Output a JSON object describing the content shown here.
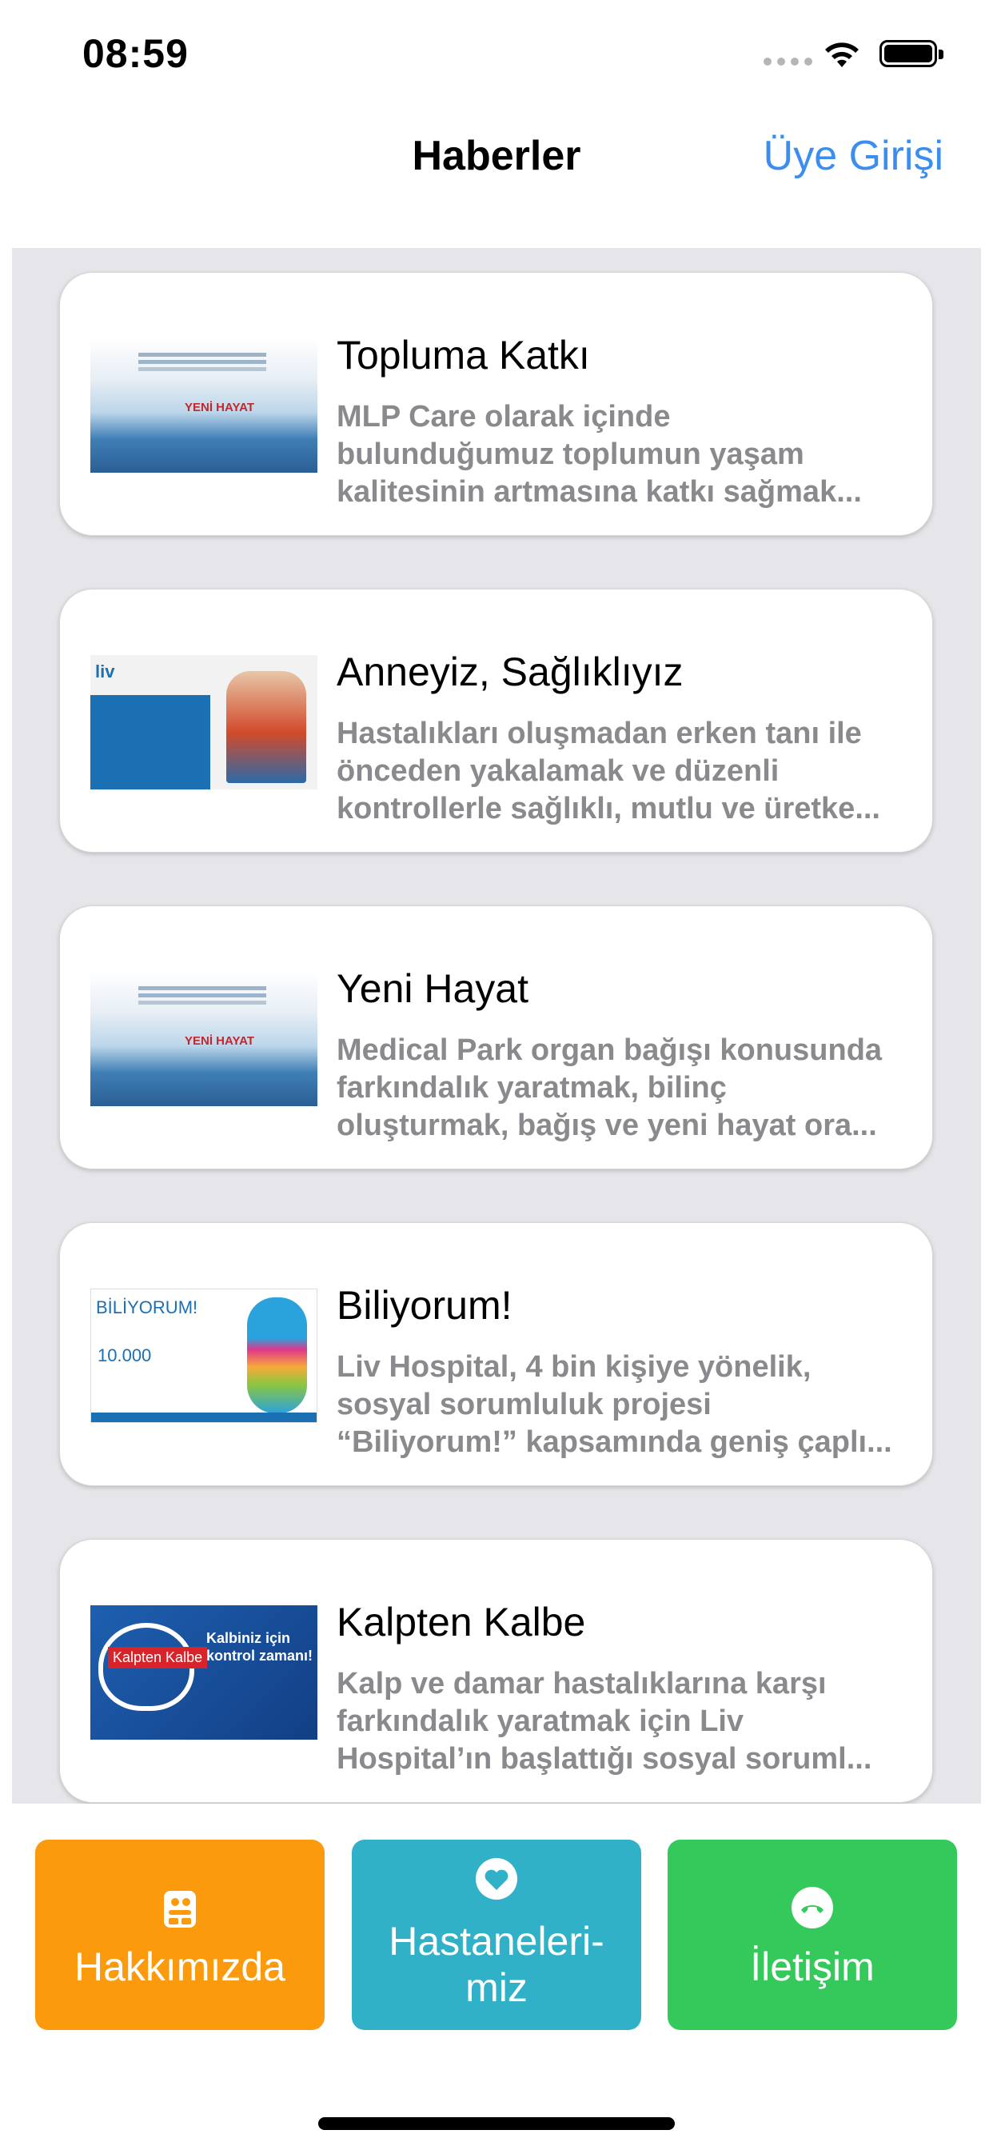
{
  "status_bar": {
    "time": "08:59"
  },
  "nav": {
    "title": "Haberler",
    "action": "Üye Girişi"
  },
  "news": [
    {
      "title": "Topluma Katkı",
      "desc_lines": [
        "MLP Care olarak içinde",
        "bulunduğumuz toplumun yaşam",
        "kalitesinin artmasına katkı sağmak..."
      ],
      "thumb": "sea",
      "thumb_text": "YENİ HAYAT"
    },
    {
      "title": "Anneyiz, Sağlıklıyız",
      "desc_lines": [
        "Hastalıkları oluşmadan erken tanı ile",
        "önceden yakalamak ve düzenli",
        "kontrollerle sağlıklı, mutlu ve üretke..."
      ],
      "thumb": "liv",
      "thumb_text": "liv"
    },
    {
      "title": "Yeni Hayat",
      "desc_lines": [
        "Medical Park organ bağışı konusunda",
        "farkındalık yaratmak, bilinç",
        "oluşturmak, bağış ve yeni hayat ora..."
      ],
      "thumb": "sea",
      "thumb_text": "YENİ HAYAT"
    },
    {
      "title": "Biliyorum!",
      "desc_lines": [
        "Liv Hospital, 4 bin kişiye yönelik,",
        "sosyal sorumluluk projesi",
        "“Biliyorum!” kapsamında geniş çaplı..."
      ],
      "thumb": "biliyorum",
      "thumb_text": "BİLİYORUM!",
      "thumb_text2": "10.000"
    },
    {
      "title": "Kalpten Kalbe",
      "desc_lines": [
        "Kalp ve damar hastalıklarına karşı",
        "farkındalık yaratmak için Liv",
        "Hospital’ın başlattığı sosyal soruml..."
      ],
      "thumb": "kalpten",
      "thumb_text": "Kalpten Kalbe",
      "thumb_text2": "Kalbiniz için kontrol zamanı!"
    }
  ],
  "tabs": {
    "about": {
      "label": "Hakkımızda",
      "icon": "building-icon",
      "color": "#fb9a0d"
    },
    "hospitals": {
      "label_line1": "Hastaneleri-",
      "label_line2": "miz",
      "icon": "heart-icon",
      "color": "#30b1c8"
    },
    "contact": {
      "label": "İletişim",
      "icon": "phone-icon",
      "color": "#35c85a"
    }
  },
  "colors": {
    "accent": "#3b8ef0",
    "list_background": "#e6e6ea"
  }
}
